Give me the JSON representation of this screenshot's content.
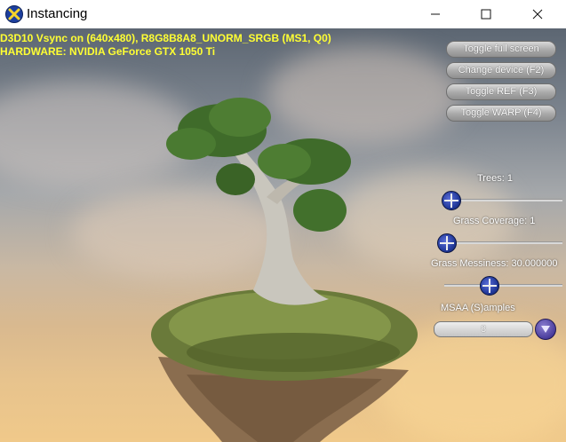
{
  "window": {
    "title": "Instancing",
    "controls": {
      "minimize": "minimize-icon",
      "maximize": "maximize-icon",
      "close": "close-icon"
    }
  },
  "hud": {
    "line1": "D3D10 Vsync on (640x480), R8G8B8A8_UNORM_SRGB (MS1, Q0)",
    "line2": "HARDWARE: NVIDIA GeForce GTX 1050 Ti",
    "color": "#ffff33"
  },
  "buttons": {
    "toggle_full_screen": "Toggle full screen",
    "change_device": "Change device (F2)",
    "toggle_ref": "Toggle REF (F3)",
    "toggle_warp": "Toggle WARP (F4)"
  },
  "controls": {
    "trees_label": "Trees: 1",
    "trees_value": 0.0,
    "grass_coverage_label": "Grass Coverage: 1",
    "grass_coverage_value": 0.0,
    "grass_messiness_label": "Grass Messiness: 30.000000",
    "grass_messiness_value": 0.5,
    "msaa_label": "MSAA (S)amples",
    "msaa_selected": "8"
  },
  "scene": {
    "description_icon": "floating-island-with-tree",
    "colors": {
      "sky_top": "#5c6672",
      "sky_bottom": "#f0c98a",
      "foliage": "#3f6b2a",
      "trunk": "#c9c6bd",
      "rock": "#8a6d4f"
    }
  }
}
